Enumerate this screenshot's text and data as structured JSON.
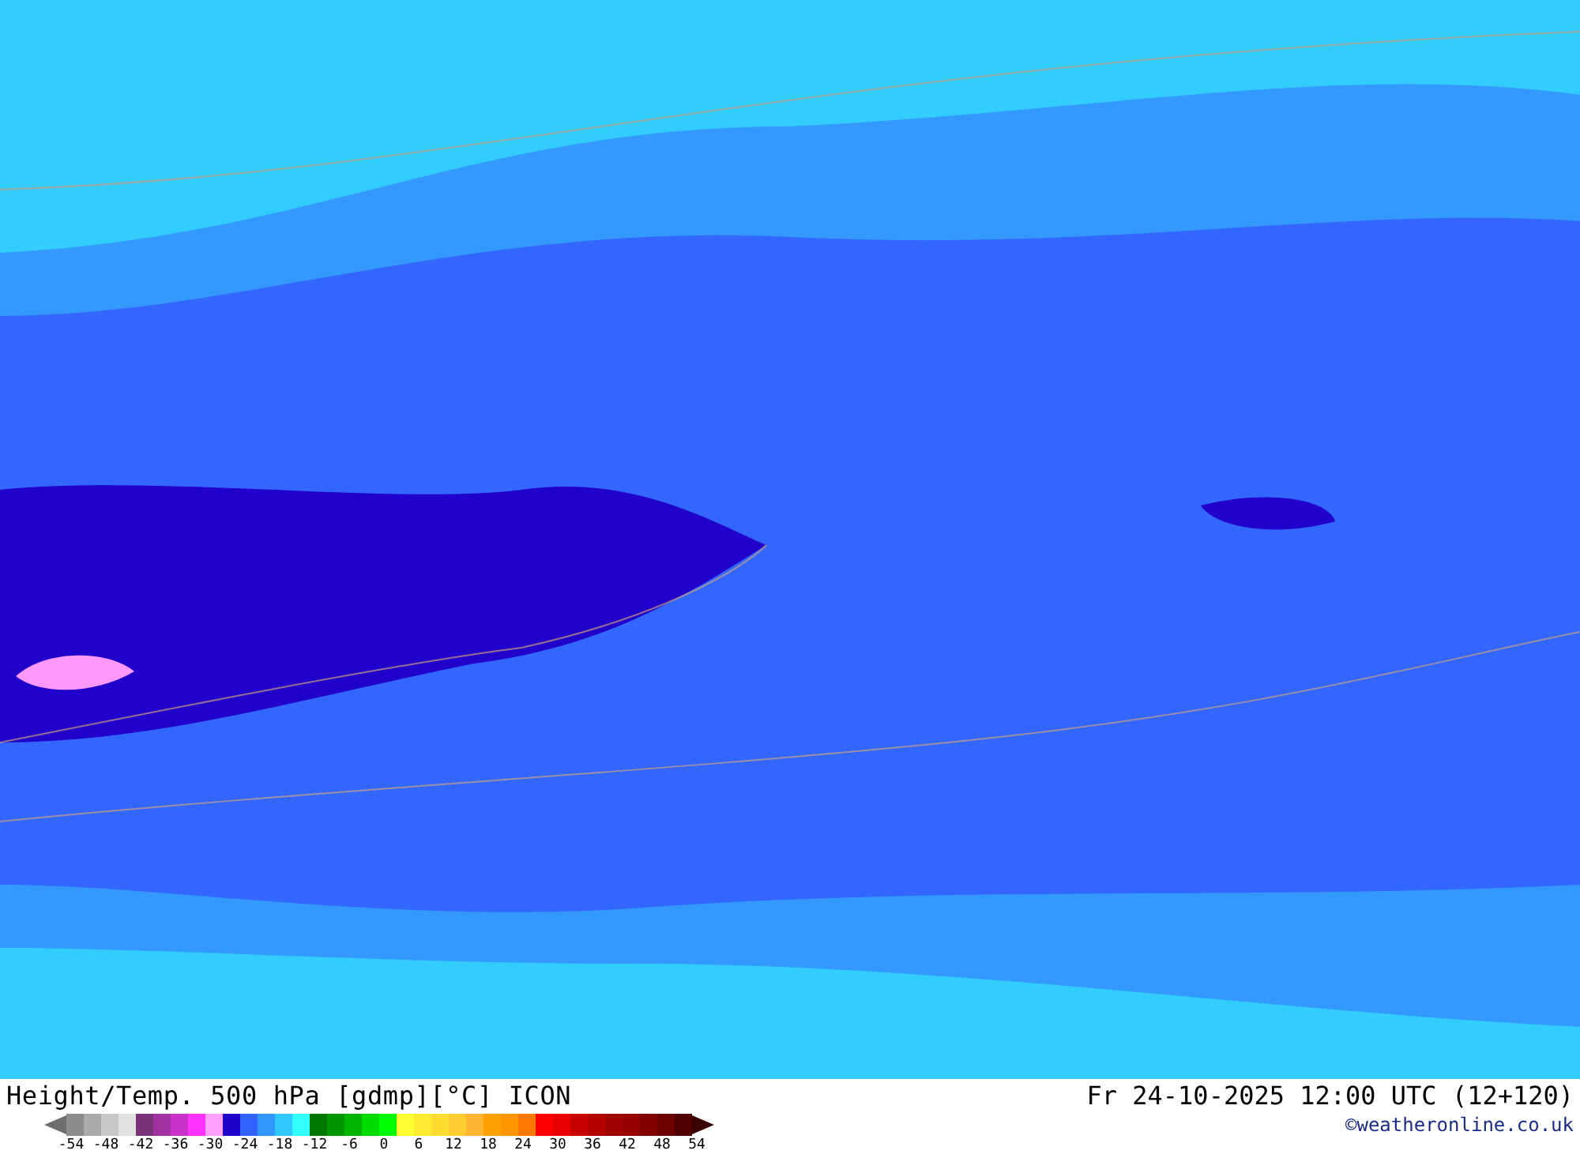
{
  "map": {
    "kind": "contour-map"
  },
  "footer": {
    "title": "Height/Temp. 500 hPa [gdmp][°C] ICON",
    "datetime": "Fr 24-10-2025 12:00 UTC (12+120)",
    "credit": "©weatheronline.co.uk"
  },
  "legend": {
    "swatches": [
      {
        "color": "#8c8c8c"
      },
      {
        "color": "#aaaaaa"
      },
      {
        "color": "#c8c8c8"
      },
      {
        "color": "#e1e1e1"
      },
      {
        "color": "#783278"
      },
      {
        "color": "#a032a0"
      },
      {
        "color": "#c832c8"
      },
      {
        "color": "#ff32ff"
      },
      {
        "color": "#ffa0ff"
      },
      {
        "color": "#1e00c8"
      },
      {
        "color": "#3264ff"
      },
      {
        "color": "#3296ff"
      },
      {
        "color": "#32c8ff"
      },
      {
        "color": "#32ffff"
      },
      {
        "color": "#007800"
      },
      {
        "color": "#009600"
      },
      {
        "color": "#00b400"
      },
      {
        "color": "#00dc00"
      },
      {
        "color": "#00ff00"
      },
      {
        "color": "#ffff32"
      },
      {
        "color": "#ffeb32"
      },
      {
        "color": "#ffdc32"
      },
      {
        "color": "#ffcd32"
      },
      {
        "color": "#ffb432"
      },
      {
        "color": "#ffa000"
      },
      {
        "color": "#ff9600"
      },
      {
        "color": "#ff7800"
      },
      {
        "color": "#ff0000"
      },
      {
        "color": "#e60000"
      },
      {
        "color": "#c80000"
      },
      {
        "color": "#b40000"
      },
      {
        "color": "#a00000"
      },
      {
        "color": "#960000"
      },
      {
        "color": "#820000"
      },
      {
        "color": "#6e0000"
      },
      {
        "color": "#500000"
      }
    ],
    "ticks": [
      "-54",
      "-48",
      "-42",
      "-36",
      "-30",
      "-24",
      "-18",
      "-12",
      "-6",
      "0",
      "6",
      "12",
      "18",
      "24",
      "30",
      "36",
      "42",
      "48",
      "54"
    ]
  }
}
